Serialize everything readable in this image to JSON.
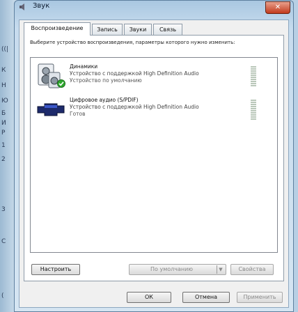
{
  "window": {
    "title": "Звук",
    "close_glyph": "✕"
  },
  "left_strip": [
    "((|",
    "К",
    "Н",
    "Ю",
    "Б",
    "И",
    "Р",
    "1",
    "2",
    "3",
    "C",
    "("
  ],
  "tabs": [
    {
      "label": "Воспроизведение",
      "active": true
    },
    {
      "label": "Запись",
      "active": false
    },
    {
      "label": "Звуки",
      "active": false
    },
    {
      "label": "Связь",
      "active": false
    }
  ],
  "instructions": "Выберите устройство воспроизведения, параметры которого нужно изменить:",
  "devices": [
    {
      "name": "Динамики",
      "description": "Устройство с поддержкой High Definition Audio",
      "status": "Устройство по умолчанию",
      "icon": "speaker-icon",
      "default": true
    },
    {
      "name": "Цифровое аудио (S/PDIF)",
      "description": "Устройство с поддержкой High Definition Audio",
      "status": "Готов",
      "icon": "spdif-connector-icon",
      "default": false
    }
  ],
  "buttons": {
    "configure": "Настроить",
    "set_default": "По умолчанию",
    "properties": "Свойства",
    "ok": "ОК",
    "cancel": "Отмена",
    "apply": "Применить"
  },
  "colors": {
    "default_check": "#2fa82f",
    "close": "#c23a1c"
  }
}
